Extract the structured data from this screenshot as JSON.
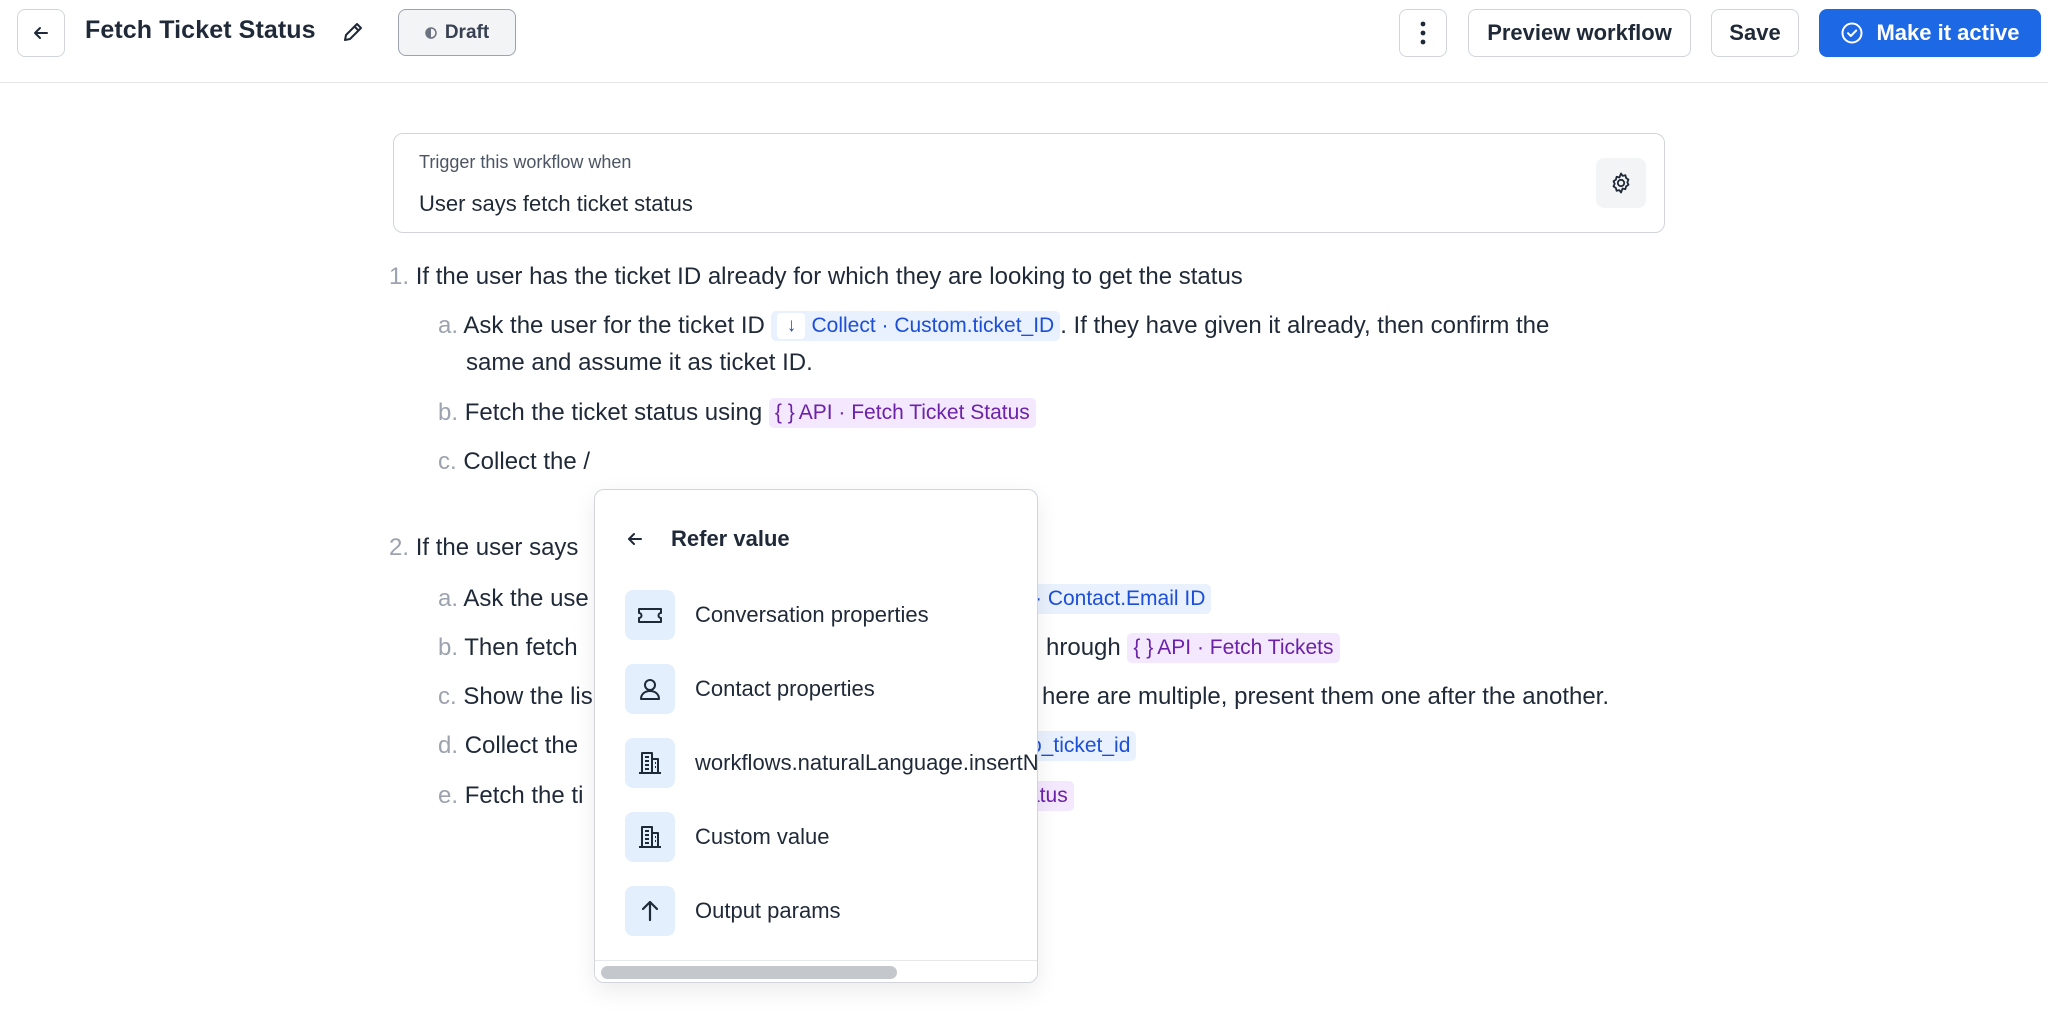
{
  "header": {
    "title": "Fetch Ticket Status",
    "status": "Draft",
    "preview_label": "Preview workflow",
    "save_label": "Save",
    "activate_label": "Make it active"
  },
  "trigger": {
    "label": "Trigger this workflow when",
    "value": "User says fetch ticket status"
  },
  "steps": {
    "s1": {
      "num": "1.",
      "text": "If the user has the ticket ID already for which they are looking to get the status"
    },
    "s1a": {
      "num": "a.",
      "before": "Ask the user for the ticket ID",
      "chip": "Collect · Custom.ticket_ID",
      "after": ". If they have given it already, then confirm the",
      "line2": "same and assume it as ticket ID."
    },
    "s1b": {
      "num": "b.",
      "before": "Fetch the ticket status using",
      "chip_glyph": "{ }",
      "chip": "API · Fetch Ticket Status"
    },
    "s1c": {
      "num": "c.",
      "text": "Collect the /"
    },
    "s2": {
      "num": "2.",
      "text": "If the user says"
    },
    "s2a": {
      "num": "a.",
      "before": "Ask the use",
      "chip": "· Contact.Email ID"
    },
    "s2b": {
      "num": "b.",
      "before": "Then fetch",
      "mid": "hrough",
      "chip_glyph": "{ }",
      "chip": "API · Fetch Tickets"
    },
    "s2c": {
      "num": "c.",
      "before": "Show the lis",
      "after": "here are multiple, present them one after the another."
    },
    "s2d": {
      "num": "d.",
      "before": "Collect the",
      "chip": "o_ticket_id"
    },
    "s2e": {
      "num": "e.",
      "before": "Fetch the ti",
      "chip": "atus"
    }
  },
  "dropdown": {
    "title": "Refer value",
    "items": [
      {
        "label": "Conversation properties",
        "icon": "ticket-icon"
      },
      {
        "label": "Contact properties",
        "icon": "user-icon"
      },
      {
        "label": "workflows.naturalLanguage.insertN",
        "icon": "building-icon"
      },
      {
        "label": "Custom value",
        "icon": "building-icon"
      },
      {
        "label": "Output params",
        "icon": "arrow-up-icon"
      }
    ]
  },
  "colors": {
    "primary": "#1d68e5",
    "collect_chip_bg": "#e8f1fd",
    "collect_chip_text": "#1d4ed8",
    "api_chip_bg": "#f3e8fd",
    "api_chip_text": "#6b21a8"
  }
}
